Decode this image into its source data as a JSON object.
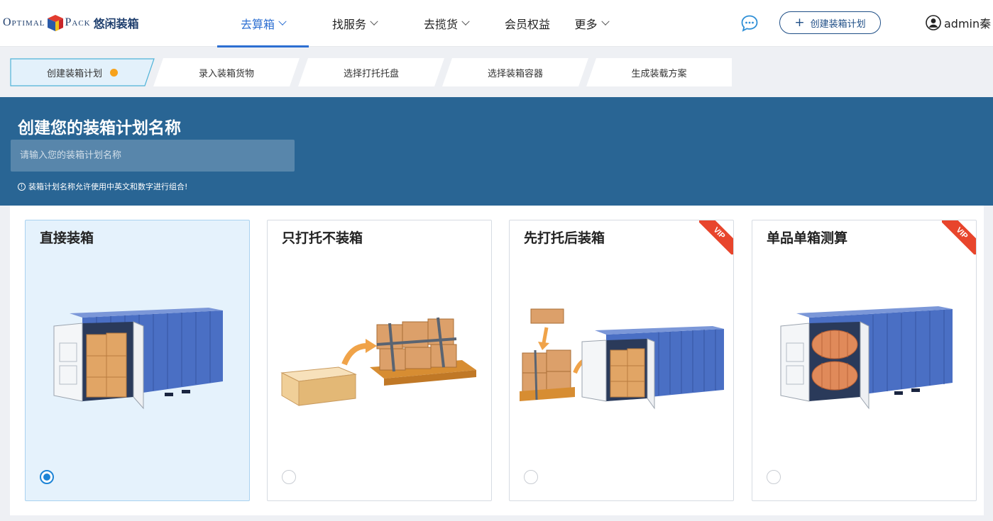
{
  "logo": {
    "word1": "Optimal",
    "word2": "Pack",
    "cn": "悠闲装箱"
  },
  "nav": [
    {
      "label": "去算箱",
      "dropdown": true,
      "active": true
    },
    {
      "label": "找服务",
      "dropdown": true,
      "active": false
    },
    {
      "label": "去揽货",
      "dropdown": true,
      "active": false
    },
    {
      "label": "会员权益",
      "dropdown": false,
      "active": false
    },
    {
      "label": "更多",
      "dropdown": true,
      "active": false
    }
  ],
  "header": {
    "create_label": "创建装箱计划",
    "user": "admin秦",
    "chat_icon": "chat-bubble-icon",
    "user_icon": "user-avatar-icon"
  },
  "steps": [
    {
      "label": "创建装箱计划",
      "current": true
    },
    {
      "label": "录入装箱货物",
      "current": false
    },
    {
      "label": "选择打托托盘",
      "current": false
    },
    {
      "label": "选择装箱容器",
      "current": false
    },
    {
      "label": "生成装载方案",
      "current": false
    }
  ],
  "banner": {
    "title": "创建您的装箱计划名称",
    "input_placeholder": "请输入您的装箱计划名称",
    "input_value": "",
    "hint": "装箱计划名称允许使用中英文和数字进行组合!"
  },
  "cards": [
    {
      "title": "直接装箱",
      "selected": true,
      "vip": false,
      "illustration": "container-with-boxes"
    },
    {
      "title": "只打托不装箱",
      "selected": false,
      "vip": false,
      "illustration": "box-to-pallet"
    },
    {
      "title": "先打托后装箱",
      "selected": false,
      "vip": true,
      "illustration": "pallet-to-container"
    },
    {
      "title": "单品单箱测算",
      "selected": false,
      "vip": true,
      "illustration": "container-with-rolls"
    }
  ],
  "vip_label": "VIP",
  "colors": {
    "accent": "#2d6fd2",
    "banner": "#296594",
    "selected_card": "#e5f2fc",
    "radio": "#1d84d6",
    "vip": "#e8452c",
    "step_dot": "#f7a21b"
  }
}
